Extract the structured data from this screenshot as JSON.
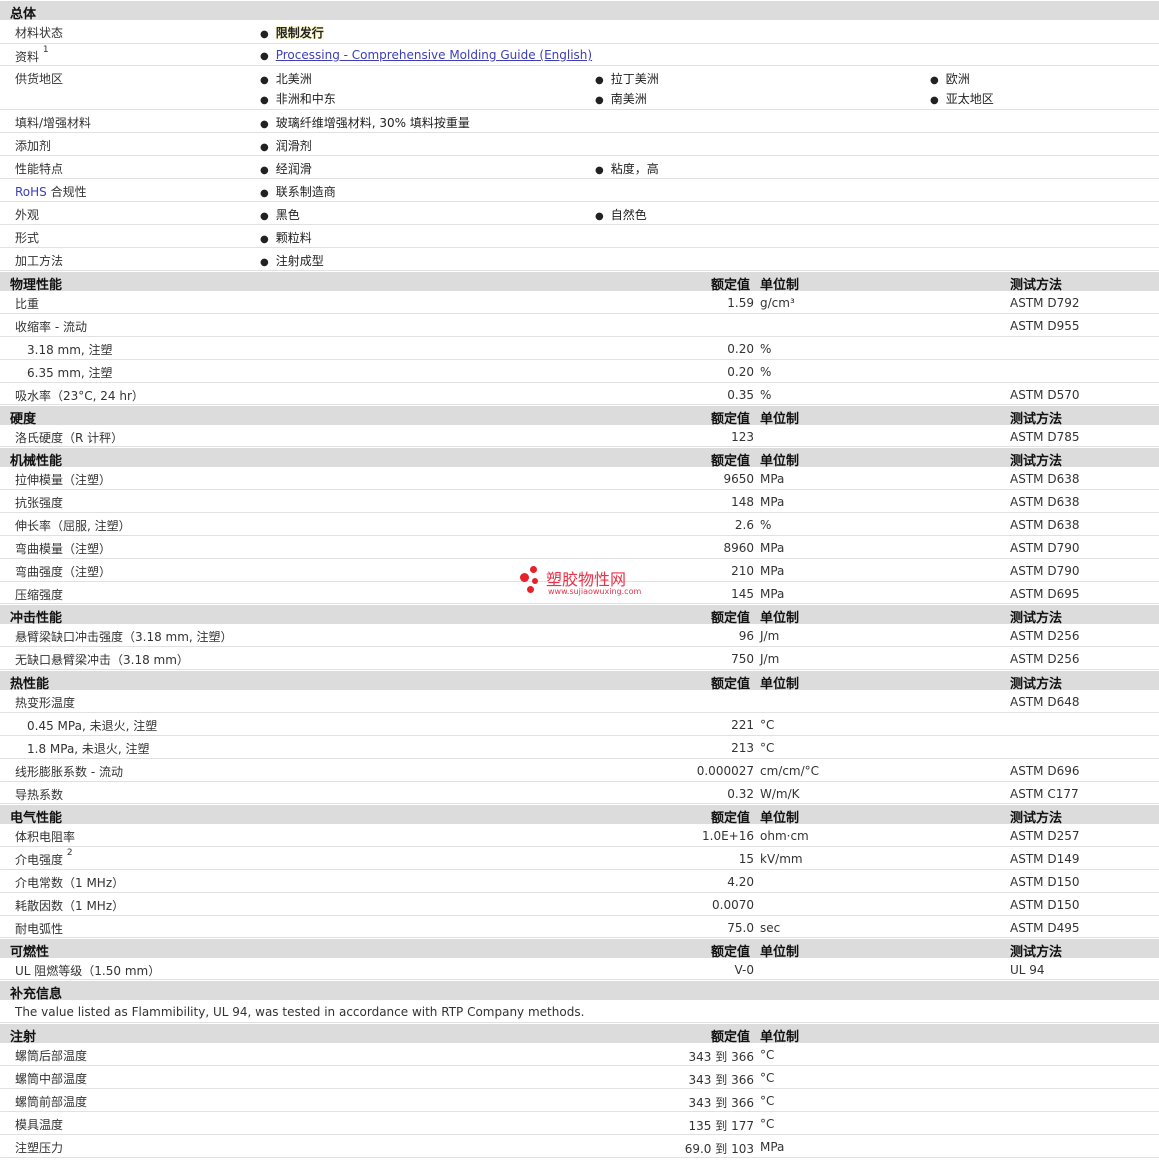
{
  "general": {
    "title": "总体",
    "material_status_label": "材料状态",
    "material_status_value": "限制发行",
    "documents_label": "资料",
    "documents_sup": "1",
    "documents_link": "Processing - Comprehensive Molding Guide (English)",
    "availability_label": "供货地区",
    "regions": [
      "北美洲",
      "拉丁美洲",
      "欧洲",
      "非洲和中东",
      "南美洲",
      "亚太地区"
    ],
    "filler_label": "填料/增强材料",
    "filler_value": "玻璃纤维增强材料, 30% 填料按重量",
    "additive_label": "添加剂",
    "additive_value": "润滑剂",
    "features_label": "性能特点",
    "features": [
      "经润滑",
      "粘度，高"
    ],
    "rohs_label_a": "RoHS",
    "rohs_label_b": " 合规性",
    "rohs_value": "联系制造商",
    "appearance_label": "外观",
    "appearance": [
      "黑色",
      "自然色"
    ],
    "form_label": "形式",
    "form_value": "颗粒料",
    "process_label": "加工方法",
    "process_value": "注射成型"
  },
  "columns": {
    "value": "额定值",
    "unit": "单位制",
    "method": "测试方法"
  },
  "physical": {
    "title": "物理性能",
    "rows": [
      {
        "label": "比重",
        "value": "1.59",
        "unit": "g/cm³",
        "method": "ASTM D792"
      },
      {
        "label": "收缩率 - 流动",
        "value": "",
        "unit": "",
        "method": "ASTM D955"
      },
      {
        "label": "3.18 mm, 注塑",
        "value": "0.20",
        "unit": "%",
        "method": ""
      },
      {
        "label": "6.35 mm, 注塑",
        "value": "0.20",
        "unit": "%",
        "method": ""
      },
      {
        "label": "吸水率（23°C, 24 hr）",
        "value": "0.35",
        "unit": "%",
        "method": "ASTM D570"
      }
    ]
  },
  "hardness": {
    "title": "硬度",
    "rows": [
      {
        "label": "洛氏硬度（R 计秤）",
        "value": "123",
        "unit": "",
        "method": "ASTM D785"
      }
    ]
  },
  "mechanical": {
    "title": "机械性能",
    "rows": [
      {
        "label": "拉伸模量（注塑）",
        "value": "9650",
        "unit": "MPa",
        "method": "ASTM D638"
      },
      {
        "label": "抗张强度",
        "value": "148",
        "unit": "MPa",
        "method": "ASTM D638"
      },
      {
        "label": "伸长率（屈服, 注塑）",
        "value": "2.6",
        "unit": "%",
        "method": "ASTM D638"
      },
      {
        "label": "弯曲模量（注塑）",
        "value": "8960",
        "unit": "MPa",
        "method": "ASTM D790"
      },
      {
        "label": "弯曲强度（注塑）",
        "value": "210",
        "unit": "MPa",
        "method": "ASTM D790"
      },
      {
        "label": "压缩强度",
        "value": "145",
        "unit": "MPa",
        "method": "ASTM D695"
      }
    ]
  },
  "impact": {
    "title": "冲击性能",
    "rows": [
      {
        "label": "悬臂梁缺口冲击强度（3.18 mm, 注塑）",
        "value": "96",
        "unit": "J/m",
        "method": "ASTM D256"
      },
      {
        "label": "无缺口悬臂梁冲击（3.18 mm）",
        "value": "750",
        "unit": "J/m",
        "method": "ASTM D256"
      }
    ]
  },
  "thermal": {
    "title": "热性能",
    "rows": [
      {
        "label": "热变形温度",
        "value": "",
        "unit": "",
        "method": "ASTM D648"
      },
      {
        "label": "0.45 MPa, 未退火, 注塑",
        "value": "221",
        "unit": "°C",
        "method": ""
      },
      {
        "label": "1.8 MPa, 未退火, 注塑",
        "value": "213",
        "unit": "°C",
        "method": ""
      },
      {
        "label": "线形膨胀系数 - 流动",
        "value": "0.000027",
        "unit": "cm/cm/°C",
        "method": "ASTM D696"
      },
      {
        "label": "导热系数",
        "value": "0.32",
        "unit": "W/m/K",
        "method": "ASTM C177"
      }
    ]
  },
  "electrical": {
    "title": "电气性能",
    "rows": [
      {
        "label": "体积电阻率",
        "value": "1.0E+16",
        "unit": "ohm·cm",
        "method": "ASTM D257"
      },
      {
        "label": "介电强度",
        "value": "15",
        "unit": "kV/mm",
        "method": "ASTM D149"
      },
      {
        "label": "介电常数（1 MHz）",
        "value": "4.20",
        "unit": "",
        "method": "ASTM D150"
      },
      {
        "label": "耗散因数（1 MHz）",
        "value": "0.0070",
        "unit": "",
        "method": "ASTM D150"
      },
      {
        "label": "耐电弧性",
        "value": "75.0",
        "unit": "sec",
        "method": "ASTM D495"
      }
    ],
    "dielectric_sup": "2"
  },
  "flammability": {
    "title": "可燃性",
    "rows": [
      {
        "label": "UL 阻燃等级（1.50 mm）",
        "value": "V-0",
        "unit": "",
        "method": "UL 94"
      }
    ]
  },
  "supplement": {
    "title": "补充信息",
    "note": "The value listed as Flammibility, UL 94, was tested in accordance with RTP Company methods."
  },
  "injection": {
    "title": "注射",
    "rows": [
      {
        "label": "螺筒后部温度",
        "v1": "343",
        "to": "到",
        "v2": "366",
        "unit": "°C"
      },
      {
        "label": "螺筒中部温度",
        "v1": "343",
        "to": "到",
        "v2": "366",
        "unit": "°C"
      },
      {
        "label": "螺筒前部温度",
        "v1": "343",
        "to": "到",
        "v2": "366",
        "unit": "°C"
      },
      {
        "label": "模具温度",
        "v1": "135",
        "to": "到",
        "v2": "177",
        "unit": "°C"
      },
      {
        "label": "注塑压力",
        "v1": "69.0",
        "to": "到",
        "v2": "103",
        "unit": "MPa"
      }
    ]
  },
  "watermark": {
    "title": "塑胶物性网",
    "url": "www.sujiaowuxing.com"
  }
}
